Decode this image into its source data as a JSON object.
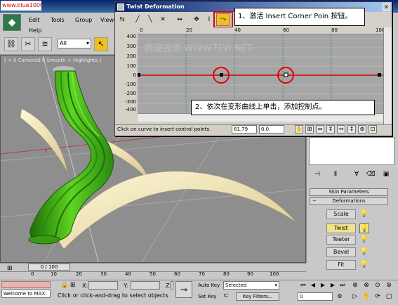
{
  "watermark": "www.blue1000.com",
  "menu": {
    "items": [
      "Edit",
      "Tools",
      "Group",
      "Views",
      "Help"
    ]
  },
  "toolbar": {
    "selection_filter": "All"
  },
  "viewport": {
    "label": "[ + 0 Camera0 0 Smooth + Highlights ]"
  },
  "dialog": {
    "title": "Twist Deformation",
    "close_glyph": "×",
    "ruler_ticks": [
      "0",
      "20",
      "40",
      "60",
      "80",
      "100"
    ],
    "y_ticks": [
      "400",
      "300",
      "200",
      "100",
      "0",
      "-100",
      "-200",
      "-300",
      "-400"
    ],
    "prompt": "Click on curve to insert control points.",
    "field_x": "61.79",
    "field_y": "0.0",
    "watermark": "腾龍视觉 WWW.TLVI.NET"
  },
  "callouts": {
    "step1": "1、激活 Insert Corner Poin 按钮。",
    "step2": "2、依次在变形曲线上单击，添加控制点。"
  },
  "command_panel": {
    "skin_parameters": "Skin Parameters",
    "deformations": "Deformations",
    "buttons": [
      "Scale",
      "Twist",
      "Teeter",
      "Bevel",
      "Fit"
    ]
  },
  "timeline": {
    "frame_indicator": "0 / 100",
    "ticks": [
      "0",
      "10",
      "20",
      "30",
      "40",
      "50",
      "60",
      "70",
      "80",
      "90",
      "100"
    ]
  },
  "status": {
    "welcome": "Welcome to MAX:",
    "prompt": "Click or click-and-drag to select objects",
    "x_label": "X:",
    "y_label": "Y:",
    "z_label": "Z:",
    "auto_key": "Auto Key",
    "set_key": "Set Key",
    "selected": "Selected",
    "key_filters": "Key Filters...",
    "frame": "0"
  },
  "colors": {
    "accent_highlight": "#f0c020",
    "annotation_red": "#e00000",
    "curve_red": "#cc0000",
    "twist_active": "#f0e28a"
  }
}
